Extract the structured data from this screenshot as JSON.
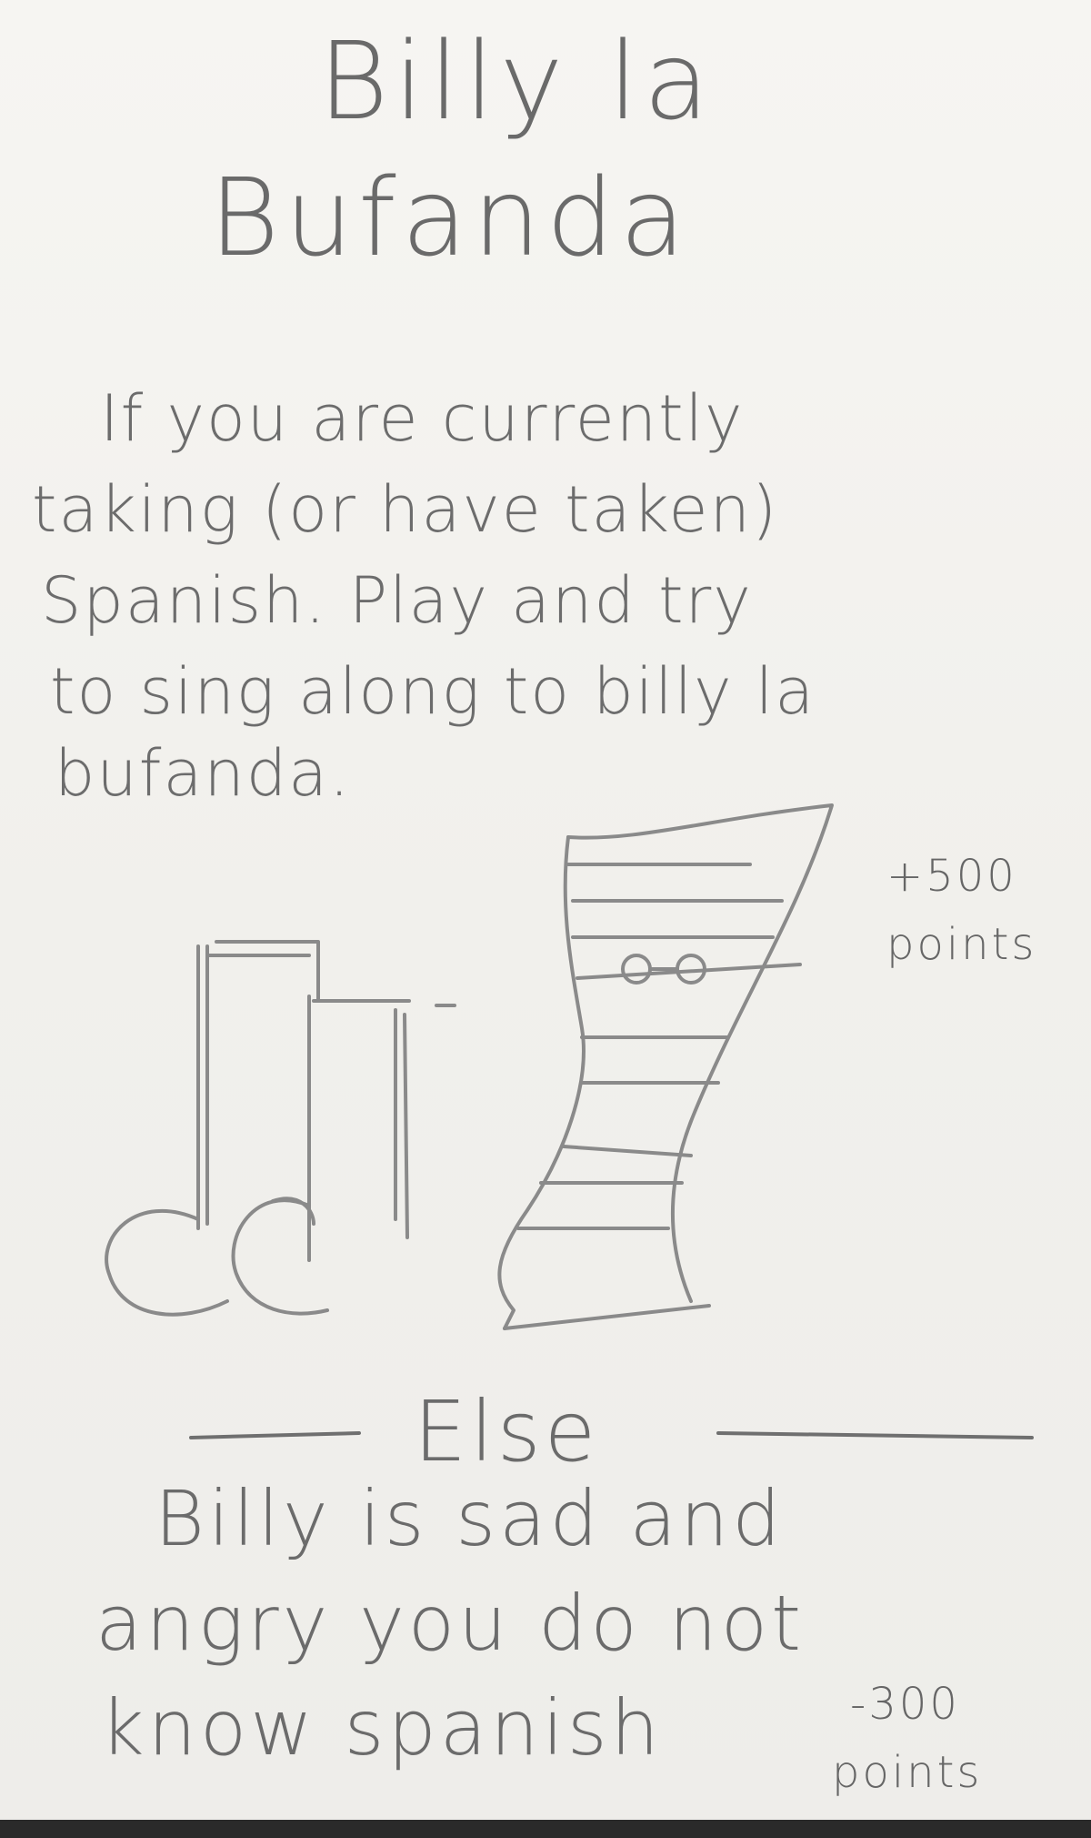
{
  "card": {
    "title": [
      "Billy la",
      "Bufanda"
    ],
    "rule": [
      "If you are currently",
      "taking (or have taken)",
      "Spanish. Play and try",
      "to sing along to billy la",
      "bufanda."
    ],
    "reward": [
      "+500",
      "points"
    ],
    "divider": "Else",
    "penalty_text": [
      "Billy is sad and",
      "angry you do not",
      "know spanish"
    ],
    "penalty_points": [
      "-300",
      "points"
    ],
    "ink_color": "#5e5e5e",
    "paper_color": "#f3f2ef"
  }
}
